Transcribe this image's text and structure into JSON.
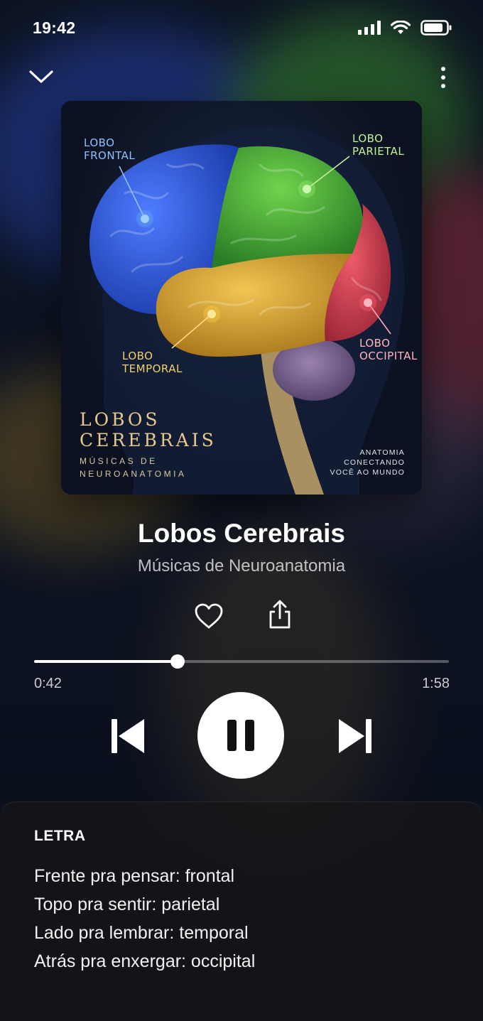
{
  "status_bar": {
    "time": "19:42"
  },
  "player": {
    "title": "Lobos Cerebrais",
    "artist": "Músicas de Neuroanatomia",
    "current_time": "0:42",
    "total_time": "1:58",
    "progress_fraction": 0.346
  },
  "cover": {
    "labels": {
      "frontal": [
        "LOBO",
        "FRONTAL"
      ],
      "parietal": [
        "LOBO",
        "PARIETAL"
      ],
      "temporal": [
        "LOBO",
        "TEMPORAL"
      ],
      "occipital": [
        "LOBO",
        "OCCIPITAL"
      ]
    },
    "title_line1": "LOBOS",
    "title_line2": "CEREBRAIS",
    "subtitle_line1": "MÚSICAS DE",
    "subtitle_line2": "NEUROANATOMIA",
    "tag_line1": "ANATOMIA",
    "tag_line2": "CONECTANDO",
    "tag_line3": "VOCÊ AO MUNDO"
  },
  "lyrics": {
    "heading": "LETRA",
    "lines": [
      "Frente pra pensar: frontal",
      "Topo pra sentir: parietal",
      "Lado pra lembrar: temporal",
      "Atrás pra enxergar: occipital"
    ]
  },
  "icons": {
    "collapse": "chevron-down-icon",
    "more": "more-vertical-icon",
    "like": "heart-icon",
    "share": "share-icon",
    "previous": "skip-previous-icon",
    "pause": "pause-icon",
    "next": "skip-next-icon"
  },
  "colors": {
    "frontal": "#2f5fe0",
    "parietal": "#3ea83a",
    "temporal": "#d9a42a",
    "occipital": "#d8404e",
    "cover_title": "#e8c98c"
  }
}
